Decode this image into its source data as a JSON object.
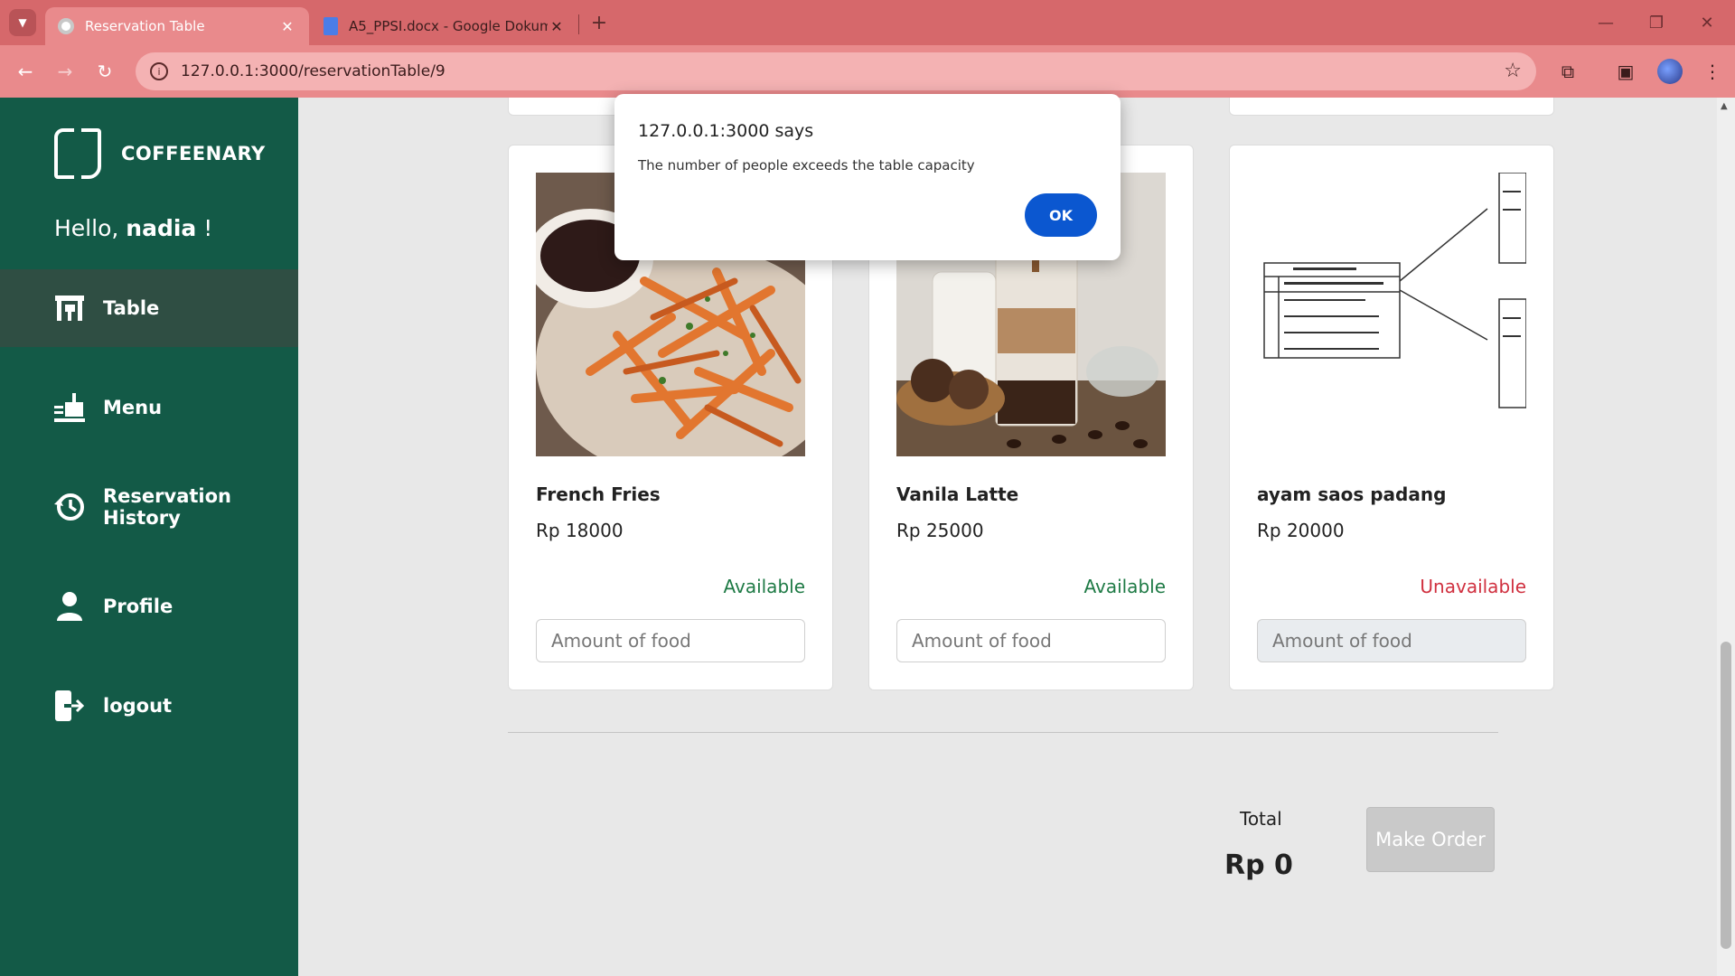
{
  "browser": {
    "tabs": [
      {
        "title": "Reservation Table",
        "close": "✕"
      },
      {
        "title": "A5_PPSI.docx - Google Dokumen",
        "close": "✕"
      }
    ],
    "new_tab": "+",
    "url": "127.0.0.1:3000/reservationTable/9"
  },
  "sidebar": {
    "brand": "COFFEENARY",
    "greeting": "Hello,",
    "username": "nadia",
    "greeting_suffix": "!",
    "items": [
      {
        "label": "Table",
        "icon": "table-icon",
        "active": true
      },
      {
        "label": "Menu",
        "icon": "food-tray-icon",
        "active": false
      },
      {
        "label": "Reservation History",
        "icon": "history-icon",
        "active": false
      },
      {
        "label": "Profile",
        "icon": "person-icon",
        "active": false
      },
      {
        "label": "logout",
        "icon": "logout-icon",
        "active": false
      }
    ]
  },
  "menu_items": [
    {
      "name": "French Fries",
      "price": "Rp 18000",
      "status": "Available",
      "available": true,
      "placeholder": "Amount of food"
    },
    {
      "name": "Vanila Latte",
      "price": "Rp 25000",
      "status": "Available",
      "available": true,
      "placeholder": "Amount of food"
    },
    {
      "name": "ayam saos padang",
      "price": "Rp 20000",
      "status": "Unavailable",
      "available": false,
      "placeholder": "Amount of food"
    }
  ],
  "order": {
    "total_label": "Total",
    "total_value": "Rp 0",
    "make_order_label": "Make Order"
  },
  "alert": {
    "title": "127.0.0.1:3000 says",
    "message": "The number of people exceeds the table capacity",
    "ok_label": "OK"
  },
  "colors": {
    "sidebar": "#135a47",
    "available": "#1e7a45",
    "unavailable": "#d0303f",
    "dialog_button": "#0b57d0",
    "browser_frame": "#d6686b"
  }
}
